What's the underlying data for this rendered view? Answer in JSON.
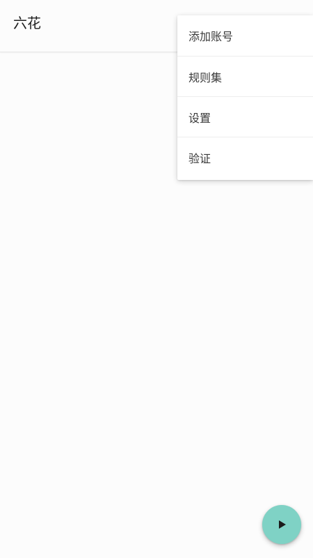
{
  "app_bar": {
    "title": "六花"
  },
  "overflow_menu": {
    "items": [
      {
        "label": "添加账号"
      },
      {
        "label": "规则集"
      },
      {
        "label": "设置"
      },
      {
        "label": "验证"
      }
    ]
  },
  "fab": {
    "icon": "play-icon",
    "color": "#7fd2c5"
  }
}
